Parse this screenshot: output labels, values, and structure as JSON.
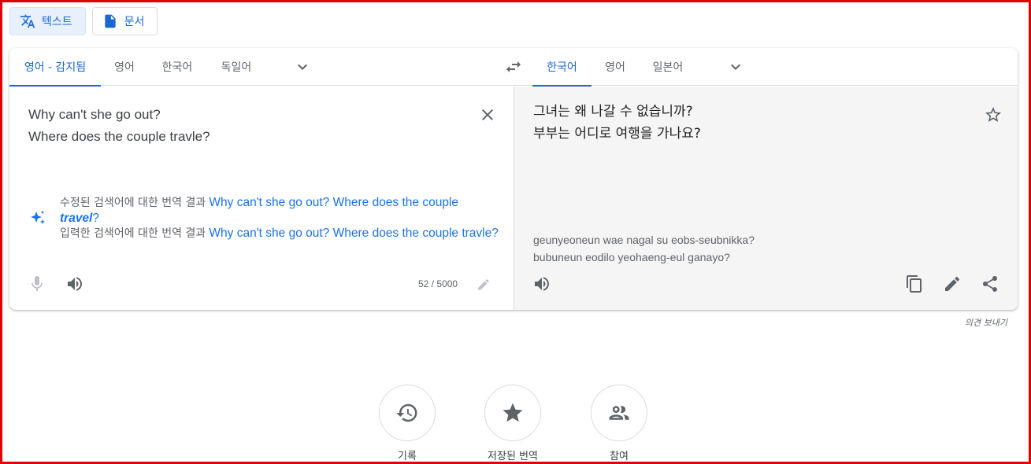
{
  "modes": [
    {
      "label": "텍스트",
      "icon": "translate-icon",
      "active": true
    },
    {
      "label": "문서",
      "icon": "document-icon",
      "active": false
    }
  ],
  "source_langs": [
    "영어 - 감지됨",
    "영어",
    "한국어",
    "독일어"
  ],
  "target_langs": [
    "한국어",
    "영어",
    "일본어"
  ],
  "source": {
    "line1": "Why can't she go out?",
    "line2": "Where does the couple travle?",
    "char_count": "52 / 5000"
  },
  "suggestion": {
    "corrected_prefix": "수정된 검색어에 대한 번역 결과",
    "corrected_link_a": "Why can't she go out? Where does the couple",
    "corrected_link_bold": "travel",
    "corrected_link_suffix": "?",
    "original_prefix": "입력한 검색어에 대한 번역 결과",
    "original_link": "Why can't she go out? Where does the couple travle?"
  },
  "target": {
    "line1": "그녀는 왜 나갈 수 없습니까?",
    "line2": "부부는 어디로 여행을 가나요?",
    "roman1": "geunyeoneun wae nagal su eobs-seubnikka?",
    "roman2": "bubuneun eodilo yeohaeng-eul ganayo?"
  },
  "feedback": "의견 보내기",
  "bottom": [
    {
      "label": "기록",
      "icon": "history-icon"
    },
    {
      "label": "저장된 번역",
      "icon": "star-icon"
    },
    {
      "label": "참여",
      "icon": "people-icon"
    }
  ],
  "colors": {
    "accent": "#1967d2",
    "link": "#1a73e8",
    "frame": "#e00000"
  }
}
